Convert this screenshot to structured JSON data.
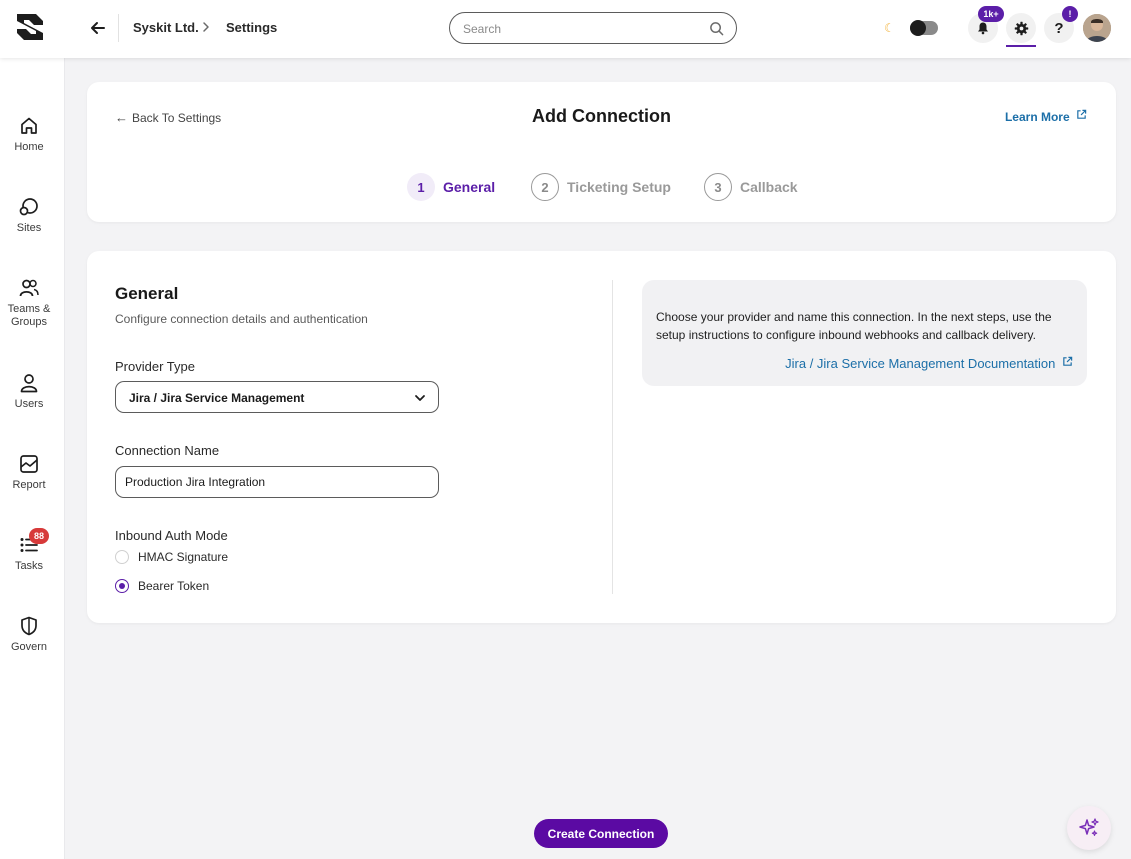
{
  "topbar": {
    "breadcrumb_org": "Syskit Ltd.",
    "breadcrumb_current": "Settings",
    "search_placeholder": "Search",
    "notifications_badge": "1k+",
    "help_badge": "!",
    "help_glyph": "?",
    "icons": [
      "syskit-logo-icon",
      "back-arrow-icon",
      "chevron-right-icon",
      "search-icon",
      "moon-icon",
      "bell-icon",
      "gear-icon",
      "help-icon"
    ]
  },
  "sidebar": {
    "items": [
      {
        "label": "Home",
        "icon": "home-icon"
      },
      {
        "label": "Sites",
        "icon": "sites-icon"
      },
      {
        "label": "Teams & Groups",
        "icon": "teams-icon"
      },
      {
        "label": "Users",
        "icon": "user-icon"
      },
      {
        "label": "Report",
        "icon": "report-icon"
      },
      {
        "label": "Tasks",
        "icon": "tasks-icon",
        "badge": "88"
      },
      {
        "label": "Govern",
        "icon": "shield-icon"
      }
    ]
  },
  "header": {
    "back_label": "Back To Settings",
    "title": "Add Connection",
    "learn_more": "Learn More",
    "steps": [
      {
        "number": "1",
        "label": "General",
        "active": true
      },
      {
        "number": "2",
        "label": "Ticketing Setup",
        "active": false
      },
      {
        "number": "3",
        "label": "Callback",
        "active": false
      }
    ]
  },
  "form": {
    "section_title": "General",
    "section_subtitle": "Configure connection details and authentication",
    "provider_label": "Provider Type",
    "provider_value": "Jira / Jira Service Management",
    "connection_name_label": "Connection Name",
    "connection_name_value": "Production Jira Integration",
    "auth_mode_label": "Inbound Auth Mode",
    "auth_options": [
      {
        "label": "HMAC Signature",
        "selected": false
      },
      {
        "label": "Bearer Token",
        "selected": true
      }
    ]
  },
  "info": {
    "text": "Choose your provider and name this connection. In the next steps, use the setup instructions to configure inbound webhooks and callback delivery.",
    "doc_link": "Jira / Jira Service Management Documentation"
  },
  "actions": {
    "create_label": "Create Connection"
  },
  "colors": {
    "accent": "#5b1ea8",
    "button": "#5b0aa3",
    "link": "#1c6fa8",
    "task_badge": "#d73a3a",
    "background": "#f3f3f5"
  }
}
